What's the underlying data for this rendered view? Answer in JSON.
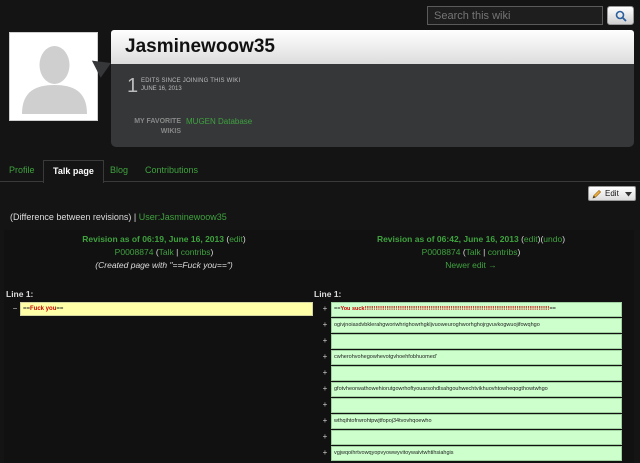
{
  "search": {
    "placeholder": "Search this wiki"
  },
  "profile": {
    "username": "Jasminewoow35",
    "edit_count": "1",
    "edit_label": "EDITS SINCE JOINING THIS WIKI",
    "edit_date": "JUNE 16, 2013",
    "favorite_label_1": "MY FAVORITE",
    "favorite_label_2": "WIKIS",
    "favorite_wiki": "MUGEN Database"
  },
  "tabs": [
    {
      "label": "Profile"
    },
    {
      "label": "Talk page"
    },
    {
      "label": "Blog"
    },
    {
      "label": "Contributions"
    }
  ],
  "toolbar": {
    "edit_label": "Edit"
  },
  "diff": {
    "header_text": "(Difference between revisions) | ",
    "header_link": "User:Jasminewoow35",
    "left": {
      "title": "Revision as of 06:19, June 16, 2013",
      "edit": "edit",
      "user": "P0008874",
      "talk": "Talk",
      "contribs": "contribs",
      "comment": "(Created page with \"==Fuck you==\")"
    },
    "right": {
      "title": "Revision as of 06:42, June 16, 2013",
      "edit": "edit",
      "undo": "undo",
      "user": "P0008874",
      "talk": "Talk",
      "contribs": "contribs",
      "newer": "Newer edit →"
    },
    "line_label": "Line 1:",
    "old_line_pre": "==",
    "old_line_red": "Fuck you",
    "old_line_post": "==",
    "new_lines": [
      {
        "pre": "==",
        "red": "You suck!!!!!!!!!!!!!!!!!!!!!!!!!!!!!!!!!!!!!!!!!!!!!!!!!!!!!!!!!!!!!!!!!!!!!!!!!!!!!!!!!!!!!!!!!!!!!!!!!!!!!",
        "post": "=="
      },
      {
        "pre": "ogivjnoiasdvbklerahgworiwhrighowrhgkljvuoweuroghworhghojrgvuvkogwuojifowqhgo",
        "red": "",
        "post": ""
      },
      {
        "pre": "",
        "red": "",
        "post": ""
      },
      {
        "pre": "cwherohvohegowhevotgvhoehfobhuomed'",
        "red": "",
        "post": ""
      },
      {
        "pre": "",
        "red": "",
        "post": ""
      },
      {
        "pre": "gfotvheorwathowehiorutgowrhoftyouarsohdlsahgouhwechtvikhuovhtowheqogthowtwhgo",
        "red": "",
        "post": ""
      },
      {
        "pre": "",
        "red": "",
        "post": ""
      },
      {
        "pre": "wthqihtofrwrohtpwjtfopoj34tvovhqoewho",
        "red": "",
        "post": ""
      },
      {
        "pre": "",
        "red": "",
        "post": ""
      },
      {
        "pre": "vgjwqoihrtvowqyopvyowwyvitoywaivtwhtihsiahgis",
        "red": "",
        "post": ""
      }
    ]
  }
}
